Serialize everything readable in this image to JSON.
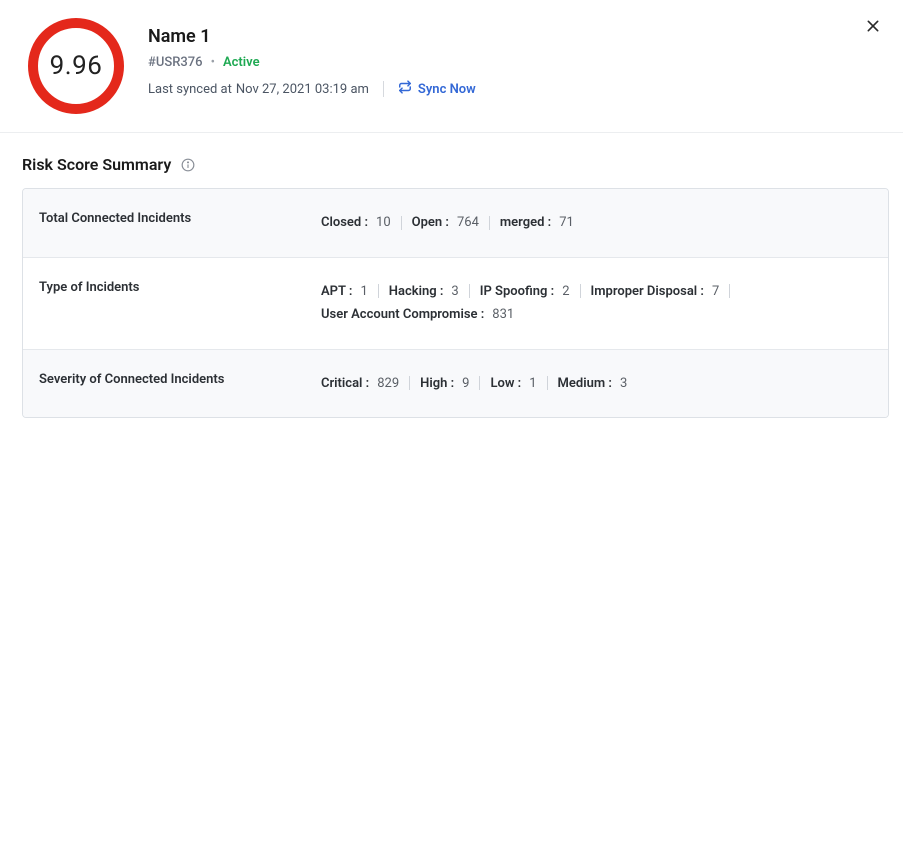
{
  "header": {
    "score": "9.96",
    "name": "Name 1",
    "user_id": "#USR376",
    "status": "Active",
    "last_synced_label": "Last synced at",
    "last_synced_value": "Nov 27, 2021 03:19 am",
    "sync_now": "Sync Now"
  },
  "section": {
    "title": "Risk Score Summary"
  },
  "rows": {
    "total": {
      "label": "Total Connected Incidents",
      "stats": [
        {
          "label": "Closed :",
          "value": "10"
        },
        {
          "label": "Open :",
          "value": "764"
        },
        {
          "label": "merged :",
          "value": "71"
        }
      ]
    },
    "type": {
      "label": "Type of Incidents",
      "stats": [
        {
          "label": "APT :",
          "value": "1"
        },
        {
          "label": "Hacking :",
          "value": "3"
        },
        {
          "label": "IP Spoofing :",
          "value": "2"
        },
        {
          "label": "Improper Disposal :",
          "value": "7"
        },
        {
          "label": "User Account Compromise :",
          "value": "831"
        }
      ]
    },
    "severity": {
      "label": "Severity of Connected Incidents",
      "stats": [
        {
          "label": "Critical :",
          "value": "829"
        },
        {
          "label": "High :",
          "value": "9"
        },
        {
          "label": "Low :",
          "value": "1"
        },
        {
          "label": "Medium :",
          "value": "3"
        }
      ]
    }
  }
}
